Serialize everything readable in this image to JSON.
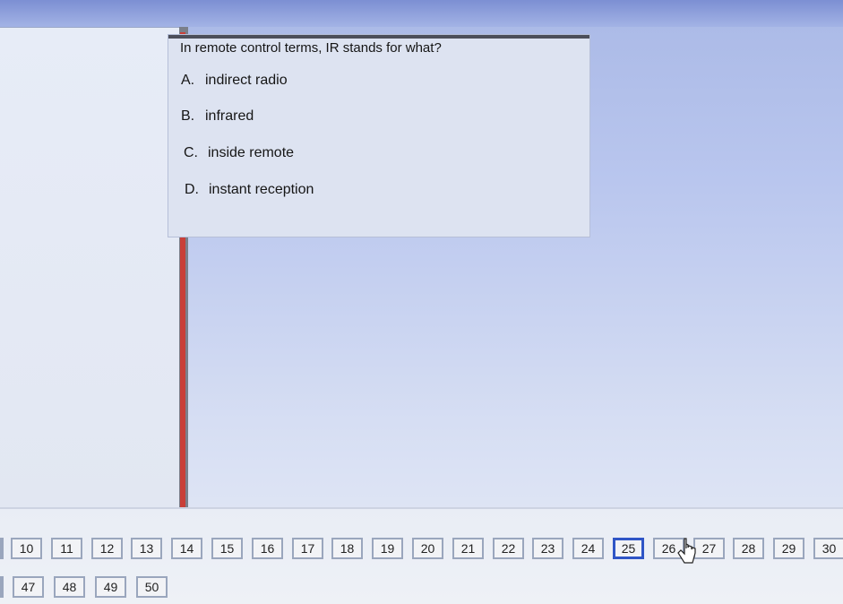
{
  "quiz": {
    "question": "In remote control terms, IR stands for what?",
    "answers": [
      {
        "letter": "A.",
        "text": "indirect radio"
      },
      {
        "letter": "B.",
        "text": "infrared"
      },
      {
        "letter": "C.",
        "text": "inside remote"
      },
      {
        "letter": "D.",
        "text": "instant reception"
      }
    ]
  },
  "navigation": {
    "current": "25",
    "row1": [
      "10",
      "11",
      "12",
      "13",
      "14",
      "15",
      "16",
      "17",
      "18",
      "19",
      "20",
      "21",
      "22",
      "23",
      "24",
      "25",
      "26",
      "27",
      "28",
      "29",
      "30"
    ],
    "row2": [
      "47",
      "48",
      "49",
      "50"
    ]
  }
}
